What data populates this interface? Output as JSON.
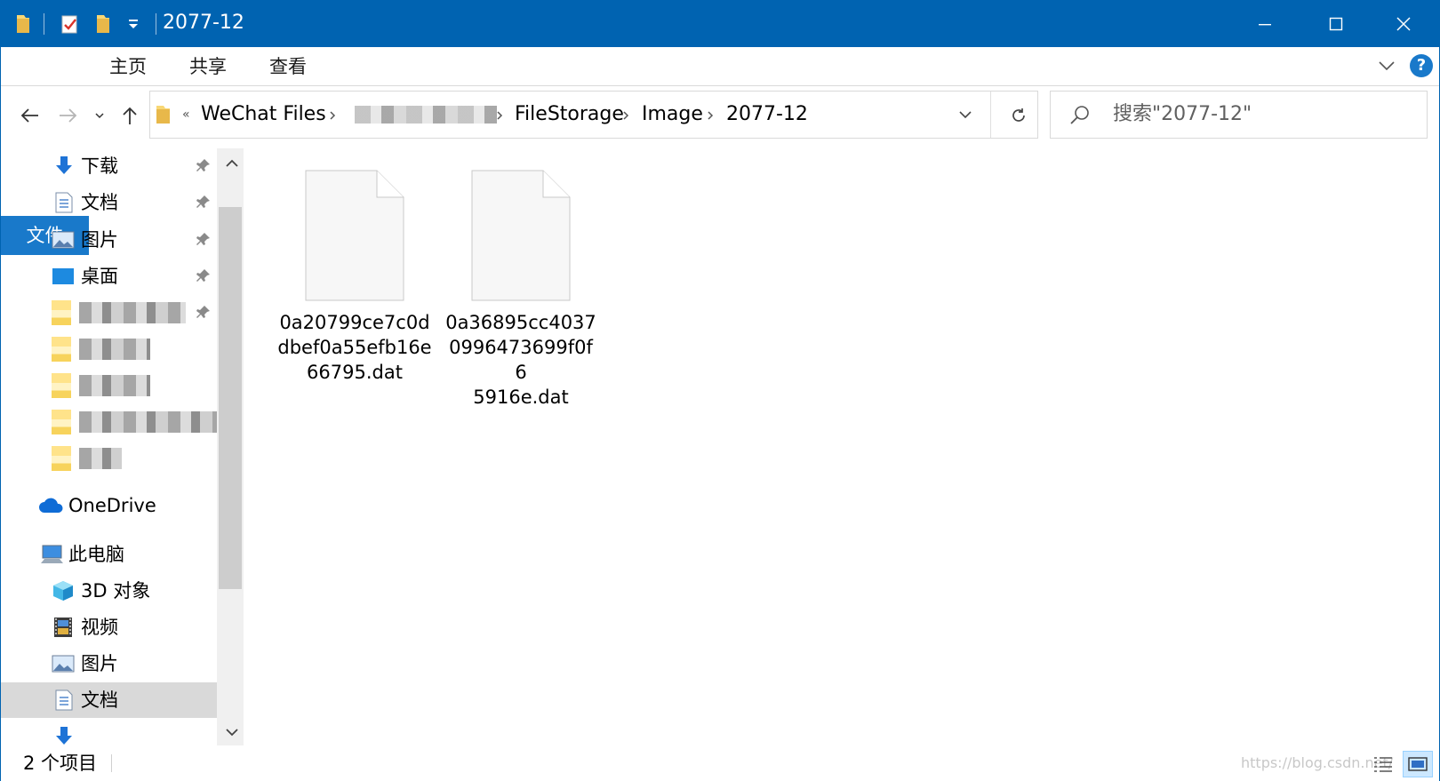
{
  "window": {
    "title": "2077-12"
  },
  "ribbon": {
    "tabs": [
      {
        "label": "文件"
      },
      {
        "label": "主页"
      },
      {
        "label": "共享"
      },
      {
        "label": "查看"
      }
    ],
    "help_label": "?"
  },
  "address": {
    "overflow": "«",
    "segments": [
      "WeChat Files",
      "FileStorage",
      "Image",
      "2077-12"
    ]
  },
  "search": {
    "placeholder": "搜索\"2077-12\""
  },
  "nav": {
    "quick_access": [
      {
        "label": "下载",
        "icon": "download-icon"
      },
      {
        "label": "文档",
        "icon": "document-icon"
      },
      {
        "label": "图片",
        "icon": "picture-icon"
      },
      {
        "label": "桌面",
        "icon": "desktop-icon"
      }
    ],
    "onedrive": "OneDrive",
    "this_pc": "此电脑",
    "pc_items": [
      {
        "label": "3D 对象",
        "icon": "3d-objects-icon"
      },
      {
        "label": "视频",
        "icon": "video-icon"
      },
      {
        "label": "图片",
        "icon": "picture-icon"
      },
      {
        "label": "文档",
        "icon": "document-icon"
      }
    ]
  },
  "files": [
    {
      "name": "0a20799ce7c0ddbef0a55efb16e66795.dat",
      "lines": [
        "0a20799ce7c0d",
        "dbef0a55efb16e",
        "66795.dat"
      ]
    },
    {
      "name": "0a36895cc40370996473699f0f65916e.dat",
      "lines": [
        "0a36895cc4037",
        "0996473699f0f6",
        "5916e.dat"
      ]
    }
  ],
  "status": {
    "item_count": "2 个项目",
    "watermark": "https://blog.csdn.net/"
  },
  "colors": {
    "titlebar": "#0063b1",
    "file_tab": "#1979ca",
    "selection": "#d9d9d9"
  }
}
